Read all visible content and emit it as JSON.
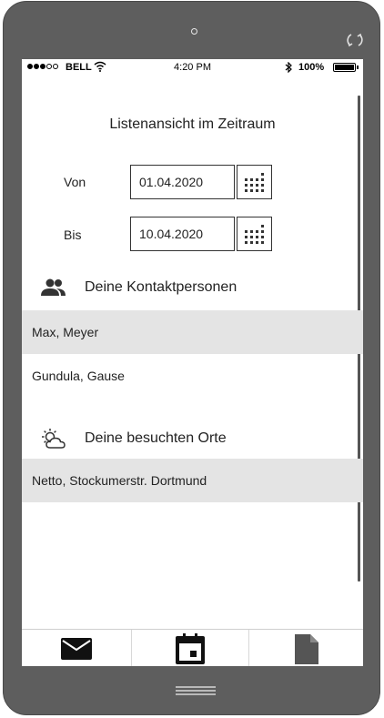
{
  "status_bar": {
    "carrier": "BELL",
    "time": "4:20 PM",
    "battery": "100%",
    "signal_bars_filled": 3,
    "signal_bars_total": 5
  },
  "page": {
    "title": "Listenansicht im Zeitraum"
  },
  "date_range": {
    "from_label": "Von",
    "from_value": "01.04.2020",
    "to_label": "Bis",
    "to_value": "10.04.2020"
  },
  "contacts": {
    "header": "Deine Kontaktpersonen",
    "icon": "people-icon",
    "items": [
      "Max, Meyer",
      "Gundula, Gause"
    ]
  },
  "places": {
    "header": "Deine besuchten Orte",
    "icon": "weather-partly-cloudy-icon",
    "items": [
      "Netto, Stockumerstr. Dortmund"
    ]
  },
  "tab_bar": {
    "tabs": [
      {
        "icon": "mail-icon"
      },
      {
        "icon": "calendar-icon"
      },
      {
        "icon": "document-icon"
      }
    ]
  },
  "colors": {
    "phone_frame": "#5e5e5e",
    "row_shade": "#e4e4e4",
    "text": "#222222"
  }
}
